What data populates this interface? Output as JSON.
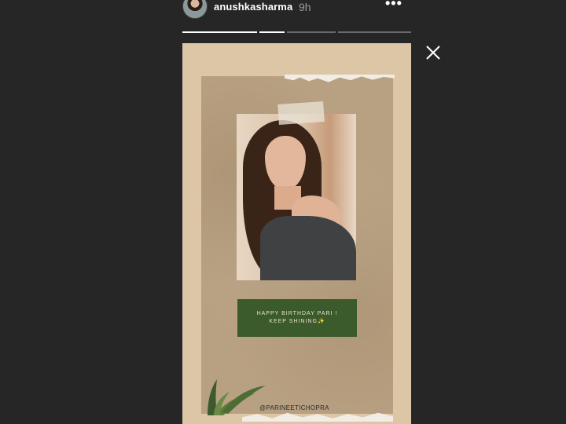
{
  "story": {
    "username": "anushkasharma",
    "time_ago": "9h",
    "progress": [
      1.0,
      1.0,
      0.0,
      0.0
    ],
    "icons": {
      "more": "more-options-icon",
      "close": "close-icon"
    },
    "post": {
      "greeting_line1": "HAPPY BIRTHDAY PARI !",
      "greeting_line2": "KEEP SHINING✨",
      "handle": "@PARINEETICHOPRA"
    }
  },
  "colors": {
    "background": "#262626",
    "progress_active": "#ffffff",
    "progress_inactive": "#6a6a6a",
    "greeting_box": "#3b5b2c"
  }
}
